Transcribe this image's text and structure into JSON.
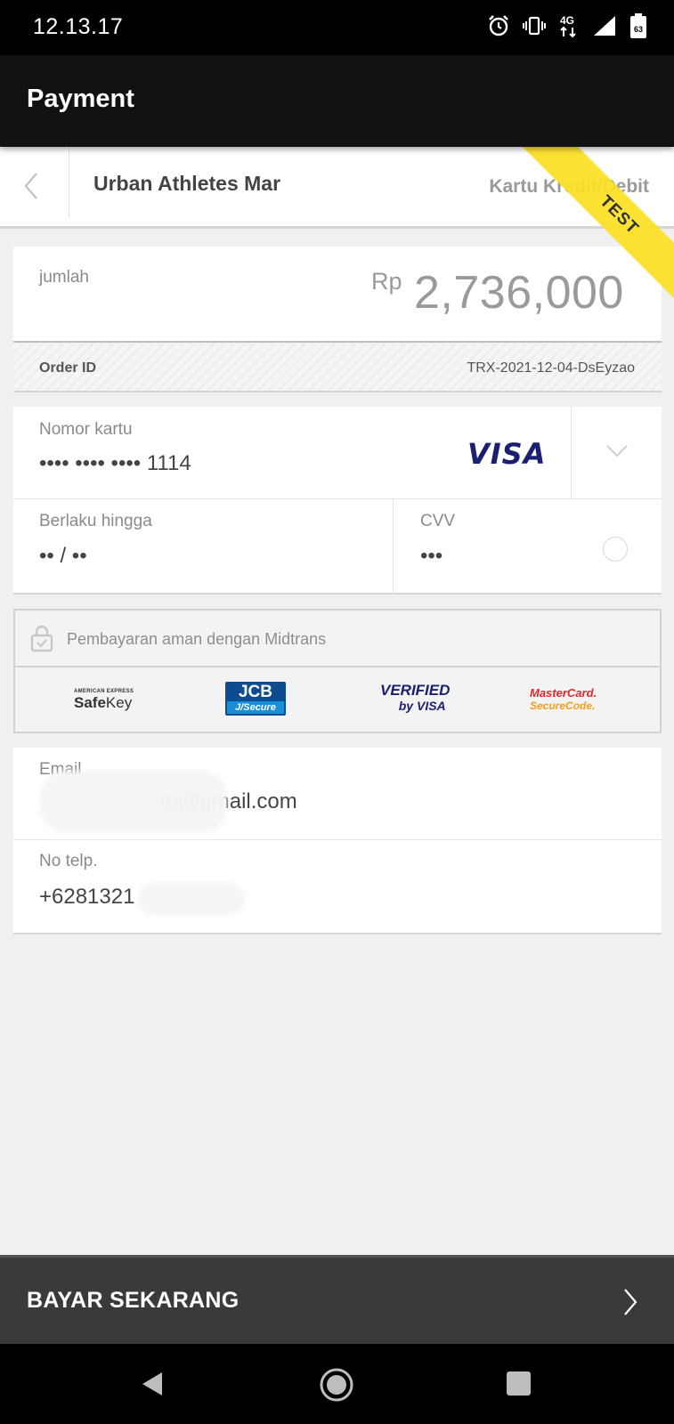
{
  "status_bar": {
    "time": "12.13.17",
    "network": "4G",
    "battery": "63",
    "icons": [
      "alarm-icon",
      "vibrate-icon",
      "network-4g-icon",
      "signal-icon",
      "battery-icon"
    ]
  },
  "app_bar": {
    "title": "Payment"
  },
  "merchant": {
    "name": "Urban Athletes Mar",
    "payment_method": "Kartu Kredit/Debit",
    "ribbon": "TEST"
  },
  "amount": {
    "label": "jumlah",
    "currency": "Rp",
    "value": "2,736,000"
  },
  "order": {
    "label": "Order ID",
    "value": "TRX-2021-12-04-DsEyzao"
  },
  "card_form": {
    "card_number_label": "Nomor kartu",
    "card_number_value": "•••• •••• •••• 1114",
    "card_brand": "VISA",
    "expiry_label": "Berlaku hingga",
    "expiry_value": "•• / ••",
    "cvv_label": "CVV",
    "cvv_value": "•••"
  },
  "secure": {
    "text": "Pembayaran aman dengan Midtrans",
    "logos": {
      "amex_small": "AMERICAN EXPRESS",
      "amex_safe": "Safe",
      "amex_key": "Key",
      "jcb_top": "JCB",
      "jcb_bottom": "J/Secure",
      "vbv_top": "VERIFIED",
      "vbv_bottom": "by VISA",
      "mc_top": "MasterCard.",
      "mc_bottom": "SecureCode."
    }
  },
  "contact": {
    "email_label": "Email",
    "email_value": "to@gmail.com",
    "phone_label": "No telp.",
    "phone_value": "+6281321"
  },
  "pay_button": {
    "label": "BAYAR SEKARANG"
  },
  "colors": {
    "ribbon": "#fce023",
    "visa_blue": "#1a1f71",
    "pay_bar": "#3a3a3a"
  }
}
